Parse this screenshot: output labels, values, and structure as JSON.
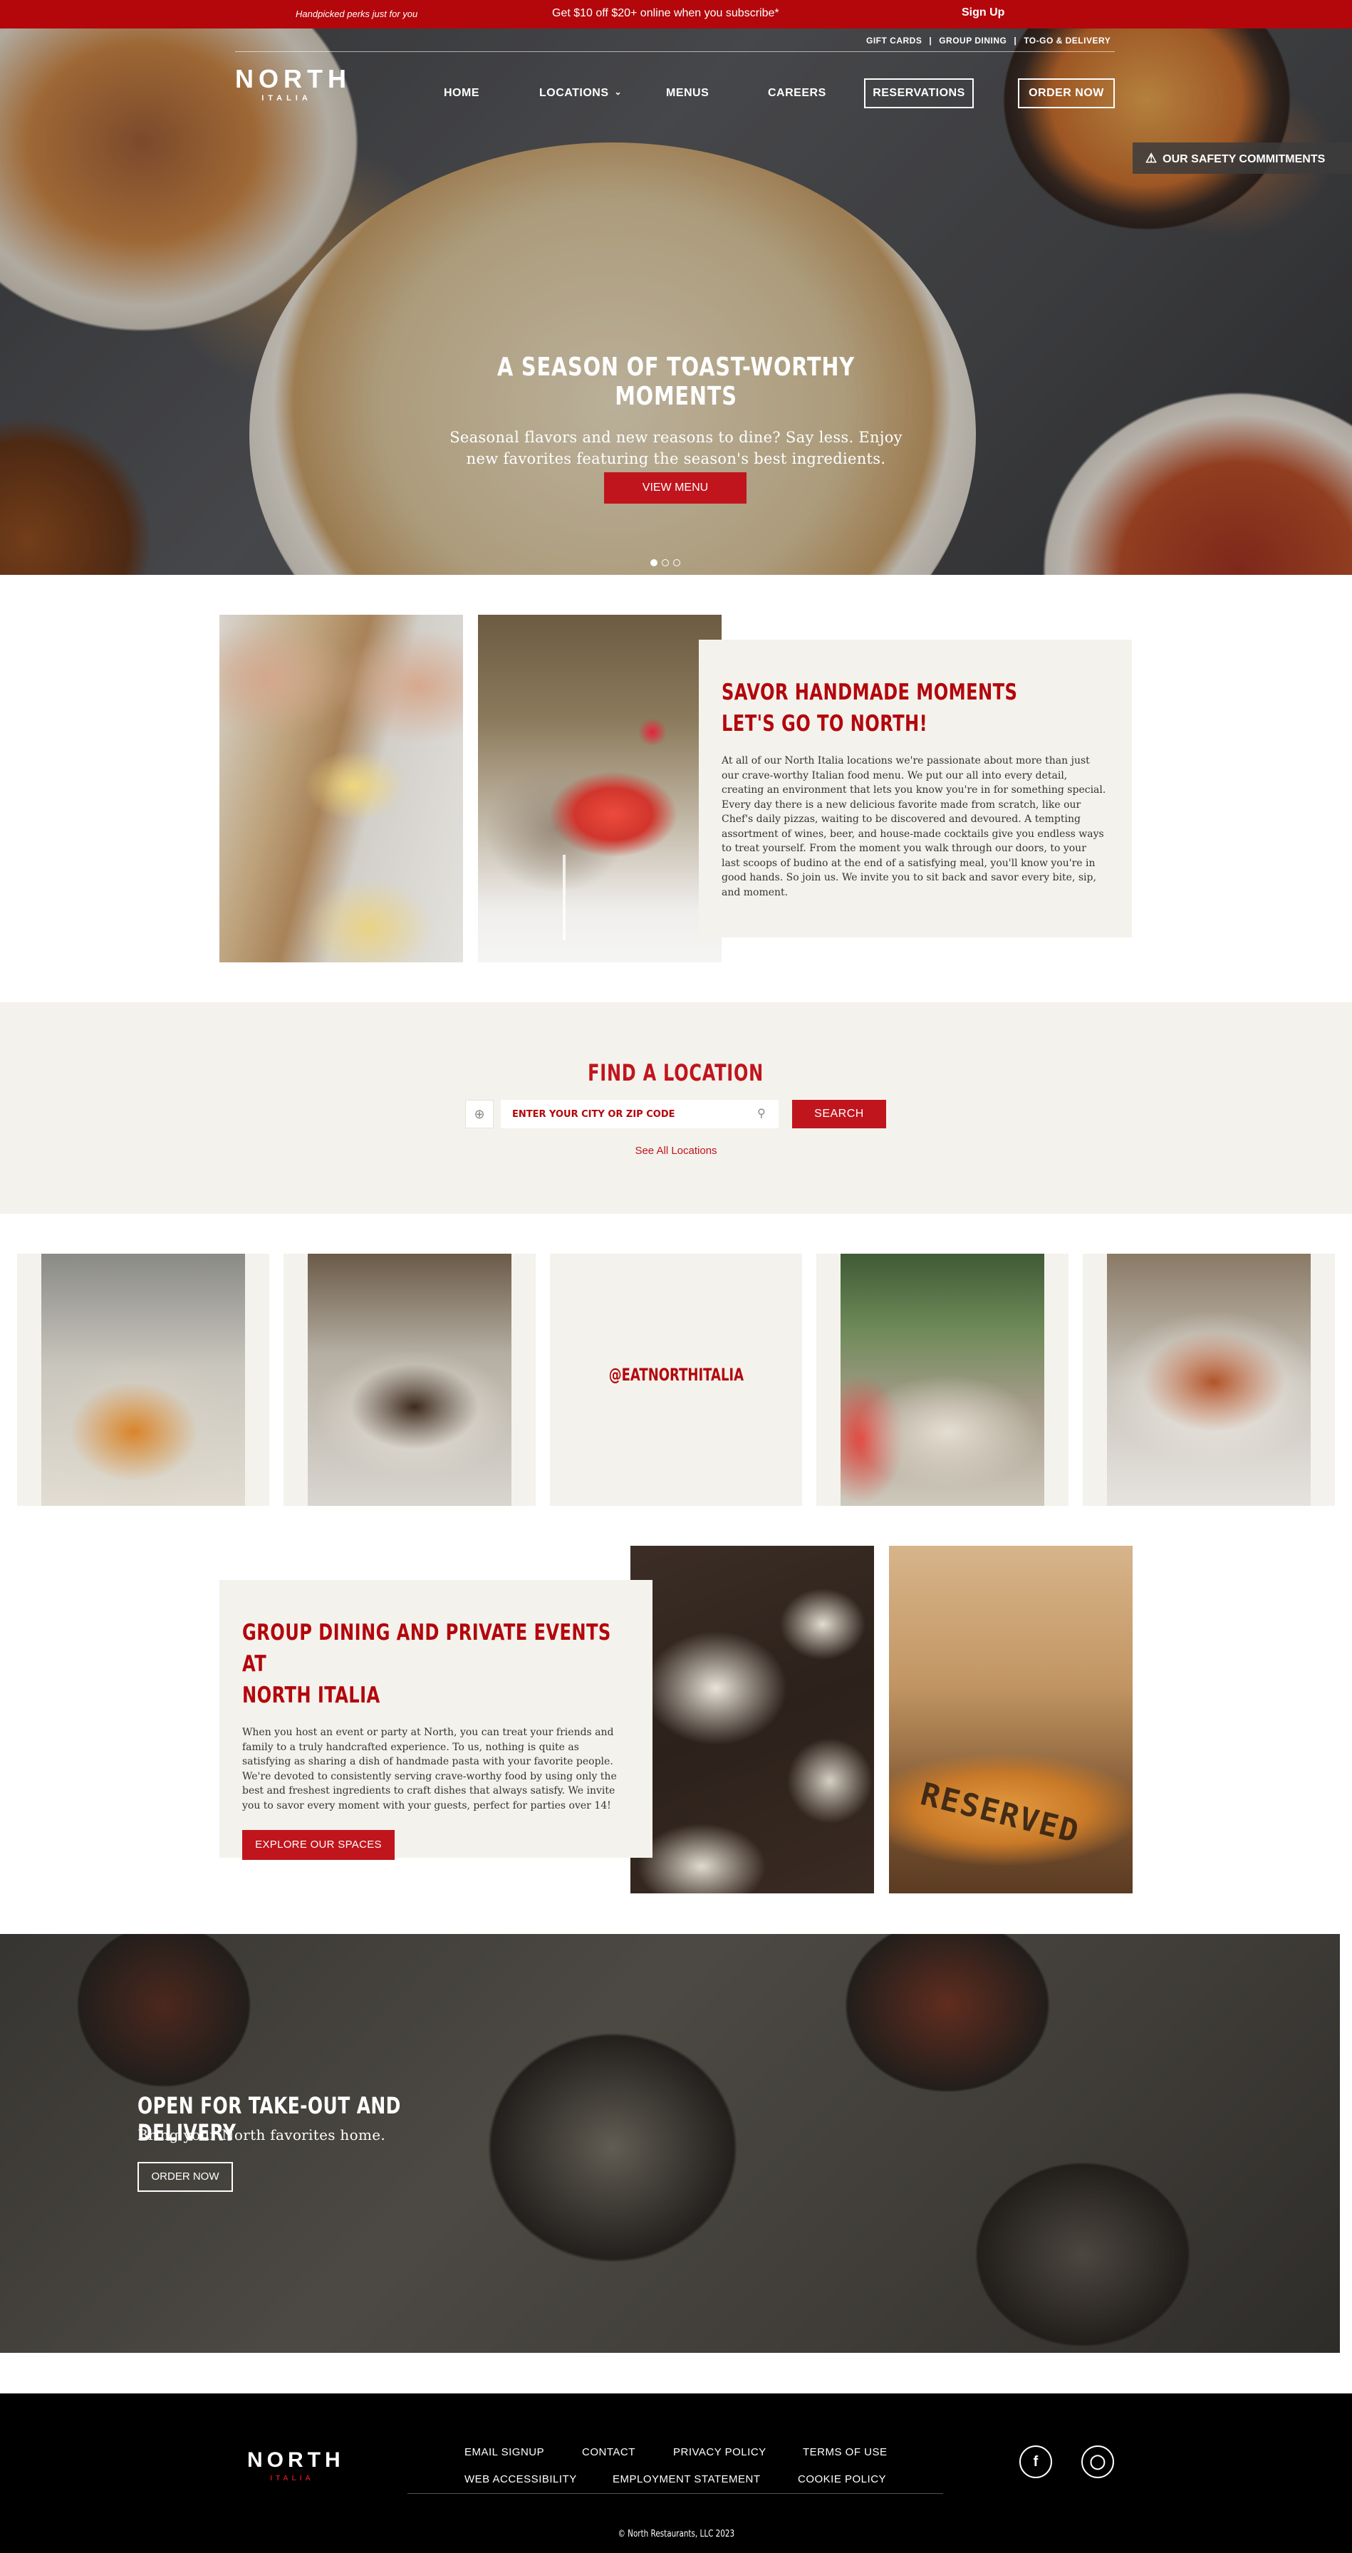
{
  "promo": {
    "perks": "Handpicked perks just for you",
    "offer": "Get $10 off $20+ online when you subscribe*",
    "signup": "Sign Up"
  },
  "utility_links": [
    "GIFT CARDS",
    "GROUP DINING",
    "TO-GO & DELIVERY"
  ],
  "logo": {
    "word": "NORTH",
    "sub": "ITALIA"
  },
  "nav": {
    "home": "HOME",
    "locations": "LOCATIONS",
    "menus": "MENUS",
    "careers": "CAREERS",
    "reservations": "RESERVATIONS",
    "order_now": "ORDER NOW"
  },
  "safety": {
    "label": "OUR SAFETY COMMITMENTS",
    "icon": "warning-icon"
  },
  "hero": {
    "title": "A SEASON OF TOAST-WORTHY MOMENTS",
    "body": "Seasonal flavors and new reasons to dine? Say less. Enjoy new favorites featuring the season's best ingredients.",
    "button": "VIEW MENU",
    "slide_count": 3,
    "active_slide": 1
  },
  "intro": {
    "title_line1": "SAVOR HANDMADE MOMENTS",
    "title_line2": "LET'S GO TO NORTH!",
    "body": "At all of our North Italia locations we're passionate about more than just our crave-worthy Italian food menu. We put our all into every detail, creating an environment that lets you know you're in for something special. Every day there is a new delicious favorite made from scratch, like our Chef's daily pizzas, waiting to be discovered and devoured. A tempting assortment of wines, beer, and house-made cocktails give you endless ways to treat yourself. From the moment you walk through our doors, to your last scoops of budino at the end of a satisfying meal, you'll know you're in good hands. So join us. We invite you to sit back and savor every bite, sip, and moment."
  },
  "find_location": {
    "title": "FIND A LOCATION",
    "placeholder": "ENTER YOUR CITY OR ZIP CODE",
    "search_button": "SEARCH",
    "see_all": "See All Locations"
  },
  "instagram": {
    "handle": "@EATNORTHITALIA"
  },
  "group_dining": {
    "title_line1": "GROUP DINING AND PRIVATE EVENTS AT",
    "title_line2": "NORTH ITALIA",
    "body": "When you host an event or party at North, you can treat your friends and family to a truly handcrafted experience. To us, nothing is quite as satisfying as sharing a dish of handmade pasta with your favorite people. We're devoted to consistently serving crave-worthy food by using only the best and freshest ingredients to craft dishes that always satisfy. We invite you to savor every moment with your guests, perfect for parties over 14!",
    "button": "EXPLORE OUR SPACES",
    "photo_sign": "RESERVED"
  },
  "takeout": {
    "title": "OPEN FOR TAKE-OUT AND DELIVERY",
    "subtitle": "Bring your North favorites home.",
    "button": "ORDER NOW"
  },
  "footer": {
    "links": [
      "EMAIL SIGNUP",
      "CONTACT",
      "PRIVACY POLICY",
      "TERMS OF USE",
      "WEB ACCESSIBILITY",
      "EMPLOYMENT STATEMENT",
      "COOKIE POLICY"
    ],
    "social": [
      "facebook-icon",
      "instagram-icon"
    ],
    "copyright": "© North Restaurants, LLC 2023"
  },
  "colors": {
    "brand_red": "#c0151d",
    "dark_red": "#b3070c",
    "cream": "#f4f2ec",
    "footer": "#000000"
  }
}
